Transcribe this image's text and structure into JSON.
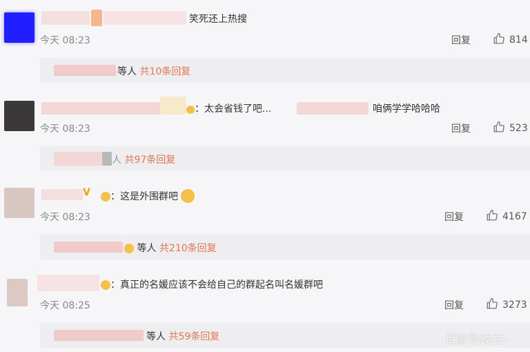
{
  "comments": [
    {
      "text": "笑死还上热搜",
      "time": "今天 08:23",
      "reply_label": "回复",
      "likes": "814",
      "sub": {
        "who": "等人",
        "count": "共10条回复"
      }
    },
    {
      "text_a": "：太会省钱了吧...",
      "text_b": "咱俩学学哈哈哈",
      "time": "今天 08:23",
      "reply_label": "回复",
      "likes": "523",
      "sub": {
        "who": "人",
        "count": "共97条回复"
      }
    },
    {
      "badge": "V",
      "text": "：这是外围群吧",
      "time": "今天 08:23",
      "reply_label": "回复",
      "likes": "4167",
      "sub": {
        "who": "等人",
        "count": "共210条回复"
      }
    },
    {
      "text": "：真正的名媛应该不会给自己的群起名叫名媛群吧",
      "time": "今天 08:25",
      "reply_label": "回复",
      "likes": "3273",
      "sub": {
        "who": "等人",
        "count": "共59条回复"
      }
    }
  ],
  "watermark": "百家号/纳兰·",
  "colors": {
    "accent": "#eb7350",
    "sub_bg": "#eeeef0",
    "avatar_blue": "#1a1aff"
  },
  "icons": {
    "like": "thumbs-up-icon",
    "emoji": "emoji-icon"
  }
}
